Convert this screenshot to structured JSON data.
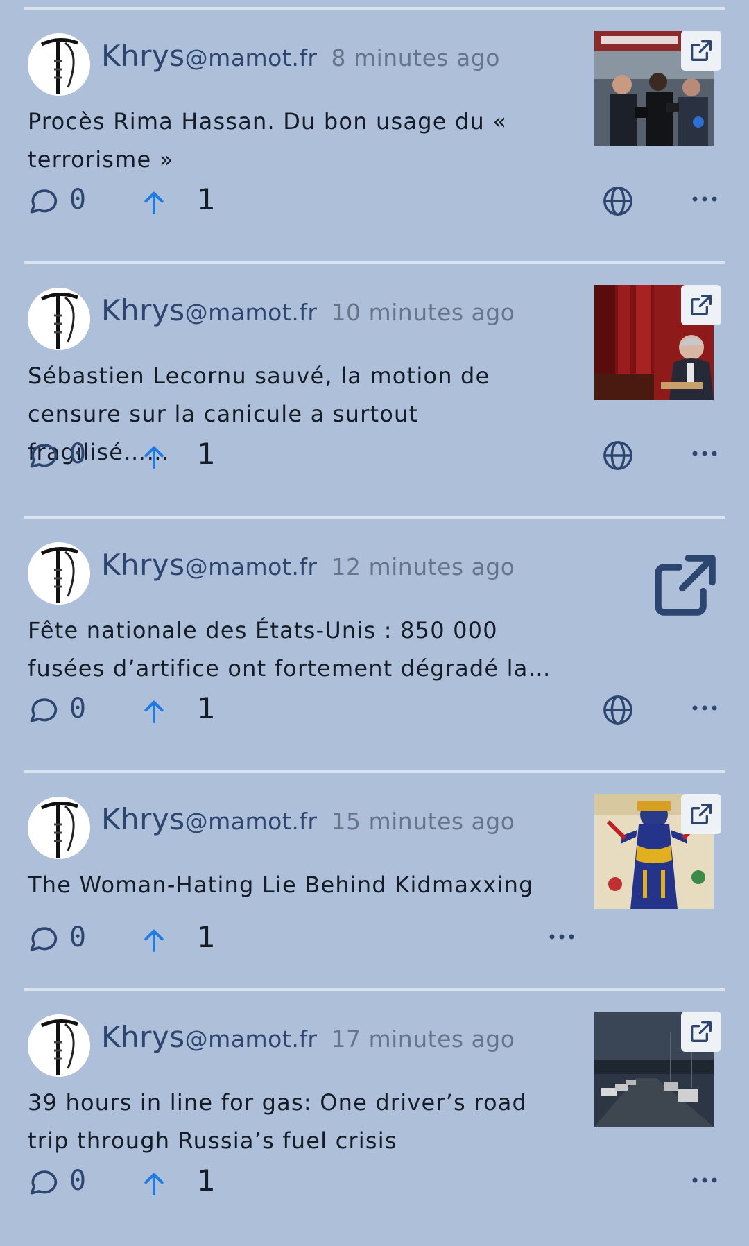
{
  "feed": {
    "posts": [
      {
        "username": "Khrys",
        "instance": "@mamot.fr",
        "time": "8 minutes ago",
        "title": "Procès Rima Hassan. Du bon usage du « terrorisme »",
        "comments": "0",
        "score": "1",
        "thumbnail": "photo-press-crowd",
        "has_globe": true
      },
      {
        "username": "Khrys",
        "instance": "@mamot.fr",
        "time": "10 minutes ago",
        "title": "Sébastien Lecornu sauvé, la motion de censure sur la canicule a surtout fragilisé……",
        "comments": "0",
        "score": "1",
        "thumbnail": "photo-assembly-red",
        "has_globe": true
      },
      {
        "username": "Khrys",
        "instance": "@mamot.fr",
        "time": "12 minutes ago",
        "title": "Fête nationale des États-Unis : 850 000 fusées d’artifice ont fortement dégradé la…",
        "comments": "0",
        "score": "1",
        "thumbnail": "external-link-icon",
        "has_globe": true
      },
      {
        "username": "Khrys",
        "instance": "@mamot.fr",
        "time": "15 minutes ago",
        "title": "The Woman-Hating Lie Behind Kidmaxxing",
        "comments": "0",
        "score": "1",
        "thumbnail": "painting-kali",
        "has_globe": false
      },
      {
        "username": "Khrys",
        "instance": "@mamot.fr",
        "time": "17 minutes ago",
        "title": "39 hours in line for gas: One driver’s road trip through Russia’s fuel crisis",
        "comments": "0",
        "score": "1",
        "thumbnail": "photo-road-dusk",
        "has_globe": false
      }
    ]
  },
  "colors": {
    "background": "#aebfd9",
    "divider": "#dbe3ef",
    "username": "#2d4670",
    "timestamp": "#66758a",
    "upvote": "#1f7be0",
    "text": "#141c25"
  },
  "icons": {
    "comment": "comment-bubble-icon",
    "upvote": "arrow-up-icon",
    "globe": "globe-icon",
    "more": "more-dots-icon",
    "external": "external-link-icon"
  }
}
